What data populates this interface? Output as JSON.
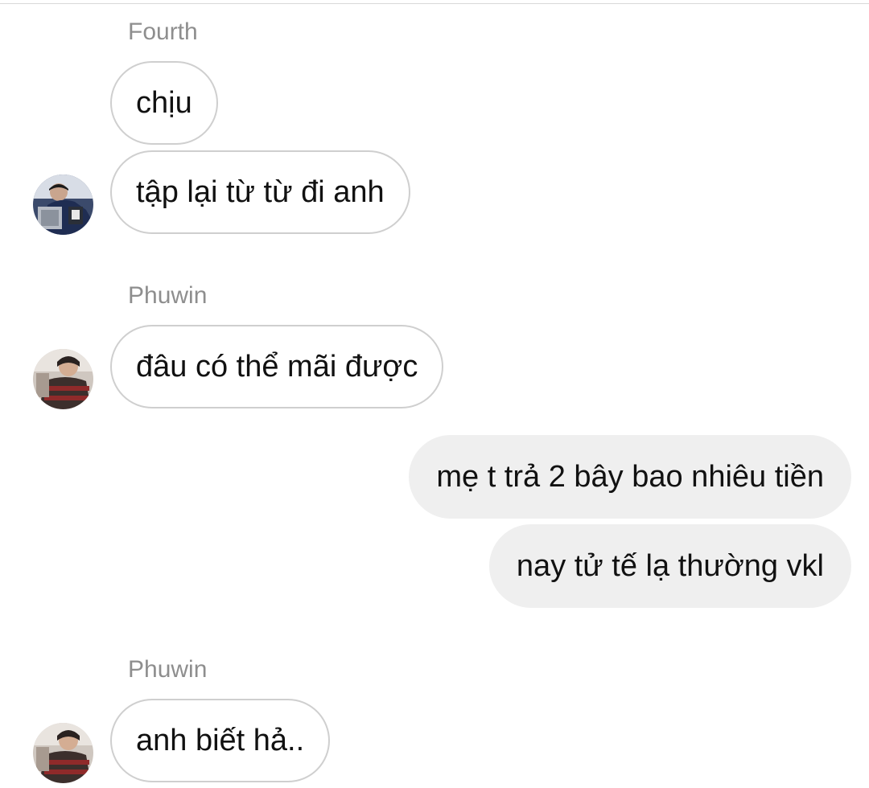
{
  "colors": {
    "incoming_border": "#cfcfcf",
    "outgoing_bg": "#efefef",
    "name_text": "#8e8e8e",
    "message_text": "#111111"
  },
  "groups": [
    {
      "sender": "Fourth",
      "avatar_icon": "profile-photo-fourth",
      "messages": [
        "chịu",
        "tập lại từ từ đi anh"
      ]
    },
    {
      "sender": "Phuwin",
      "avatar_icon": "profile-photo-phuwin",
      "messages": [
        "đâu có thể mãi được"
      ]
    },
    {
      "sender": "",
      "outgoing": true,
      "messages": [
        "mẹ t trả 2 bây bao nhiêu tiền",
        "nay tử tế lạ thường vkl"
      ]
    },
    {
      "sender": "Phuwin",
      "avatar_icon": "profile-photo-phuwin",
      "messages": [
        "anh biết hả.."
      ]
    }
  ]
}
